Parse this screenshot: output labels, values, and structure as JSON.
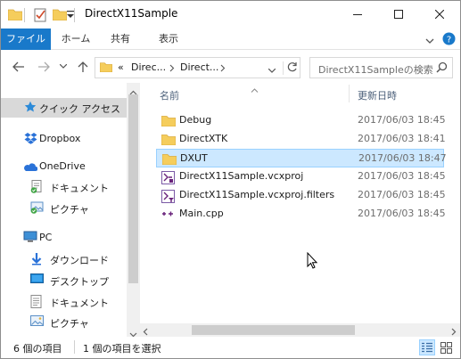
{
  "window": {
    "title": "DirectX11Sample"
  },
  "ribbon": {
    "tabs": [
      "ファイル",
      "ホーム",
      "共有",
      "表示"
    ]
  },
  "address": {
    "prefix": "«",
    "crumbs": [
      "Direc...",
      "Direct..."
    ]
  },
  "search": {
    "placeholder": "DirectX11Sampleの検索"
  },
  "nav": {
    "quick_access": "クイック アクセス",
    "dropbox": "Dropbox",
    "onedrive": "OneDrive",
    "onedrive_documents": "ドキュメント",
    "onedrive_pictures": "ピクチャ",
    "pc": "PC",
    "downloads": "ダウンロード",
    "desktop": "デスクトップ",
    "documents": "ドキュメント",
    "pictures": "ピクチャ"
  },
  "columns": {
    "name": "名前",
    "modified": "更新日時"
  },
  "files": [
    {
      "name": "Debug",
      "date": "2017/06/03 18:45",
      "icon": "folder-icon"
    },
    {
      "name": "DirectXTK",
      "date": "2017/06/03 18:41",
      "icon": "folder-icon"
    },
    {
      "name": "DXUT",
      "date": "2017/06/03 18:47",
      "icon": "folder-icon"
    },
    {
      "name": "DirectX11Sample.vcxproj",
      "date": "2017/06/03 18:45",
      "icon": "vcxproj-icon"
    },
    {
      "name": "DirectX11Sample.vcxproj.filters",
      "date": "2017/06/03 18:45",
      "icon": "filters-icon"
    },
    {
      "name": "Main.cpp",
      "date": "2017/06/03 18:45",
      "icon": "cpp-icon"
    }
  ],
  "selected_file_index": 2,
  "status": {
    "count": "6 個の項目",
    "selection": "1 個の項目を選択"
  },
  "colors": {
    "accent": "#1979ca",
    "folder": "#f5cd5c",
    "selection": "#cce8ff"
  }
}
